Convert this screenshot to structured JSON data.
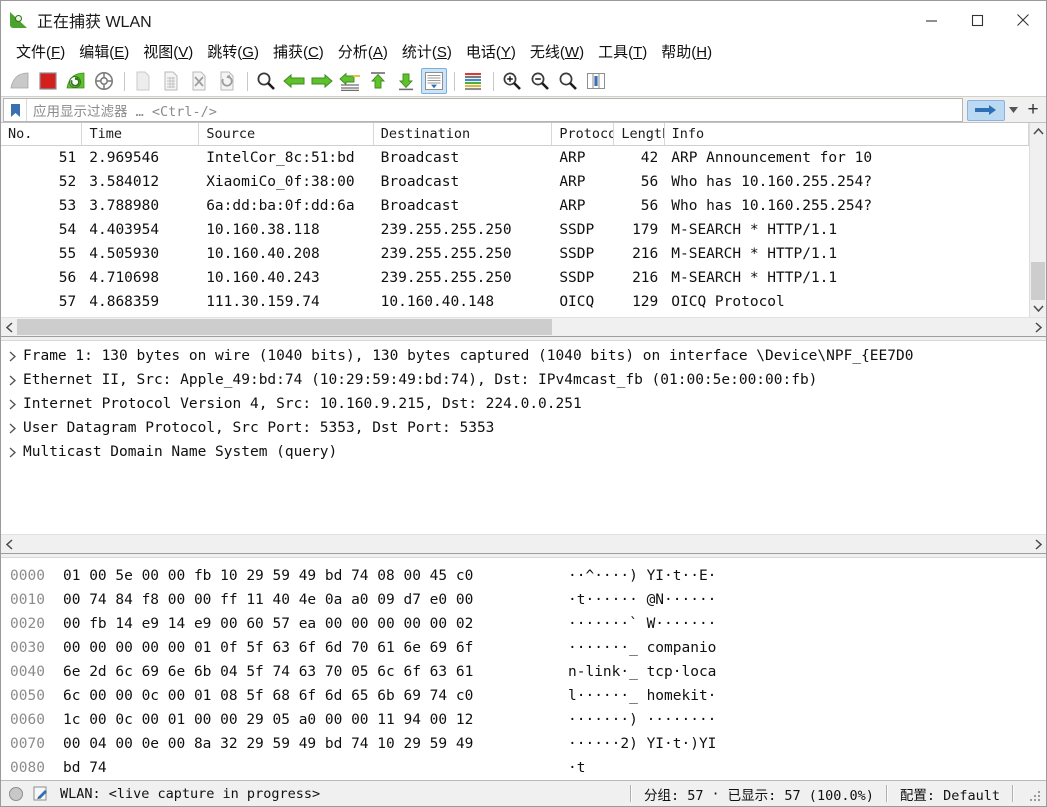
{
  "window": {
    "title": "正在捕获 WLAN",
    "minimize_label": "最小化",
    "maximize_label": "最大化",
    "close_label": "关闭"
  },
  "menu": [
    {
      "label": "文件(F)",
      "text": "文件",
      "accel": "F"
    },
    {
      "label": "编辑(E)",
      "text": "编辑",
      "accel": "E"
    },
    {
      "label": "视图(V)",
      "text": "视图",
      "accel": "V"
    },
    {
      "label": "跳转(G)",
      "text": "跳转",
      "accel": "G"
    },
    {
      "label": "捕获(C)",
      "text": "捕获",
      "accel": "C"
    },
    {
      "label": "分析(A)",
      "text": "分析",
      "accel": "A"
    },
    {
      "label": "统计(S)",
      "text": "统计",
      "accel": "S"
    },
    {
      "label": "电话(Y)",
      "text": "电话",
      "accel": "Y"
    },
    {
      "label": "无线(W)",
      "text": "无线",
      "accel": "W"
    },
    {
      "label": "工具(T)",
      "text": "工具",
      "accel": "T"
    },
    {
      "label": "帮助(H)",
      "text": "帮助",
      "accel": "H"
    }
  ],
  "toolbar": {
    "items": [
      {
        "name": "start-capture-icon",
        "enabled": false
      },
      {
        "name": "stop-capture-icon",
        "enabled": true
      },
      {
        "name": "restart-capture-icon",
        "enabled": true
      },
      {
        "name": "capture-options-icon",
        "enabled": true
      },
      {
        "name": "separator"
      },
      {
        "name": "open-file-icon",
        "enabled": false
      },
      {
        "name": "save-file-icon",
        "enabled": false
      },
      {
        "name": "close-file-icon",
        "enabled": false
      },
      {
        "name": "reload-file-icon",
        "enabled": false
      },
      {
        "name": "separator"
      },
      {
        "name": "find-packet-icon",
        "enabled": true
      },
      {
        "name": "go-back-icon",
        "enabled": true
      },
      {
        "name": "go-forward-icon",
        "enabled": true
      },
      {
        "name": "go-to-packet-icon",
        "enabled": true
      },
      {
        "name": "go-first-packet-icon",
        "enabled": true
      },
      {
        "name": "go-last-packet-icon",
        "enabled": true
      },
      {
        "name": "auto-scroll-icon",
        "enabled": true,
        "selected": true
      },
      {
        "name": "separator"
      },
      {
        "name": "colorize-icon",
        "enabled": true
      },
      {
        "name": "separator"
      },
      {
        "name": "zoom-in-icon",
        "enabled": true
      },
      {
        "name": "zoom-out-icon",
        "enabled": true
      },
      {
        "name": "zoom-reset-icon",
        "enabled": true
      },
      {
        "name": "resize-columns-icon",
        "enabled": true
      }
    ]
  },
  "filter": {
    "placeholder": "应用显示过滤器 … <Ctrl-/>",
    "value": "",
    "apply_label": "应用",
    "add_label": "+"
  },
  "packet_list": {
    "columns": [
      "No.",
      "Time",
      "Source",
      "Destination",
      "Protocol",
      "Length",
      "Info"
    ],
    "rows": [
      {
        "no": "51",
        "time": "2.969546",
        "source": "IntelCor_8c:51:bd",
        "destination": "Broadcast",
        "protocol": "ARP",
        "length": "42",
        "info": "ARP Announcement for 10"
      },
      {
        "no": "52",
        "time": "3.584012",
        "source": "XiaomiCo_0f:38:00",
        "destination": "Broadcast",
        "protocol": "ARP",
        "length": "56",
        "info": "Who has 10.160.255.254?"
      },
      {
        "no": "53",
        "time": "3.788980",
        "source": "6a:dd:ba:0f:dd:6a",
        "destination": "Broadcast",
        "protocol": "ARP",
        "length": "56",
        "info": "Who has 10.160.255.254?"
      },
      {
        "no": "54",
        "time": "4.403954",
        "source": "10.160.38.118",
        "destination": "239.255.255.250",
        "protocol": "SSDP",
        "length": "179",
        "info": "M-SEARCH * HTTP/1.1"
      },
      {
        "no": "55",
        "time": "4.505930",
        "source": "10.160.40.208",
        "destination": "239.255.255.250",
        "protocol": "SSDP",
        "length": "216",
        "info": "M-SEARCH * HTTP/1.1"
      },
      {
        "no": "56",
        "time": "4.710698",
        "source": "10.160.40.243",
        "destination": "239.255.255.250",
        "protocol": "SSDP",
        "length": "216",
        "info": "M-SEARCH * HTTP/1.1"
      },
      {
        "no": "57",
        "time": "4.868359",
        "source": "111.30.159.74",
        "destination": "10.160.40.148",
        "protocol": "OICQ",
        "length": "129",
        "info": "OICQ Protocol"
      }
    ]
  },
  "packet_detail": {
    "lines": [
      "Frame 1: 130 bytes on wire (1040 bits), 130 bytes captured (1040 bits) on interface \\Device\\NPF_{EE7D0",
      "Ethernet II, Src: Apple_49:bd:74 (10:29:59:49:bd:74), Dst: IPv4mcast_fb (01:00:5e:00:00:fb)",
      "Internet Protocol Version 4, Src: 10.160.9.215, Dst: 224.0.0.251",
      "User Datagram Protocol, Src Port: 5353, Dst Port: 5353",
      "Multicast Domain Name System (query)"
    ]
  },
  "hex_dump": {
    "rows": [
      {
        "offset": "0000",
        "bytes": "01 00 5e 00 00 fb 10 29   59 49 bd 74 08 00 45 c0",
        "ascii": "··^····) YI·t··E·"
      },
      {
        "offset": "0010",
        "bytes": "00 74 84 f8 00 00 ff 11   40 4e 0a a0 09 d7 e0 00",
        "ascii": "·t······ @N······"
      },
      {
        "offset": "0020",
        "bytes": "00 fb 14 e9 14 e9 00 60   57 ea 00 00 00 00 00 02",
        "ascii": "·······` W·······"
      },
      {
        "offset": "0030",
        "bytes": "00 00 00 00 00 01 0f 5f   63 6f 6d 70 61 6e 69 6f",
        "ascii": "·······_ companio"
      },
      {
        "offset": "0040",
        "bytes": "6e 2d 6c 69 6e 6b 04 5f   74 63 70 05 6c 6f 63 61",
        "ascii": "n-link·_ tcp·loca"
      },
      {
        "offset": "0050",
        "bytes": "6c 00 00 0c 00 01 08 5f   68 6f 6d 65 6b 69 74 c0",
        "ascii": "l······_ homekit·"
      },
      {
        "offset": "0060",
        "bytes": "1c 00 0c 00 01 00 00 29   05 a0 00 00 11 94 00 12",
        "ascii": "·······) ········"
      },
      {
        "offset": "0070",
        "bytes": "00 04 00 0e 00 8a 32 29   59 49 bd 74 10 29 59 49",
        "ascii": "······2) YI·t·)YI"
      },
      {
        "offset": "0080",
        "bytes": "bd 74",
        "ascii": "·t"
      }
    ]
  },
  "status_bar": {
    "capture_text": "WLAN: <live capture in progress>",
    "packets_label": "分组: 57",
    "separator": "·",
    "displayed_label": "已显示: 57 (100.0%)",
    "profile_label": "配置: Default"
  },
  "colors": {
    "accent_green": "#4aa32c",
    "stop_red": "#d41f1f",
    "selection_blue": "#cde3f7",
    "apply_button_blue": "#bcd9f3",
    "bookmark_blue": "#3a6fb0",
    "scrollbar_thumb": "#cdcdcd"
  }
}
